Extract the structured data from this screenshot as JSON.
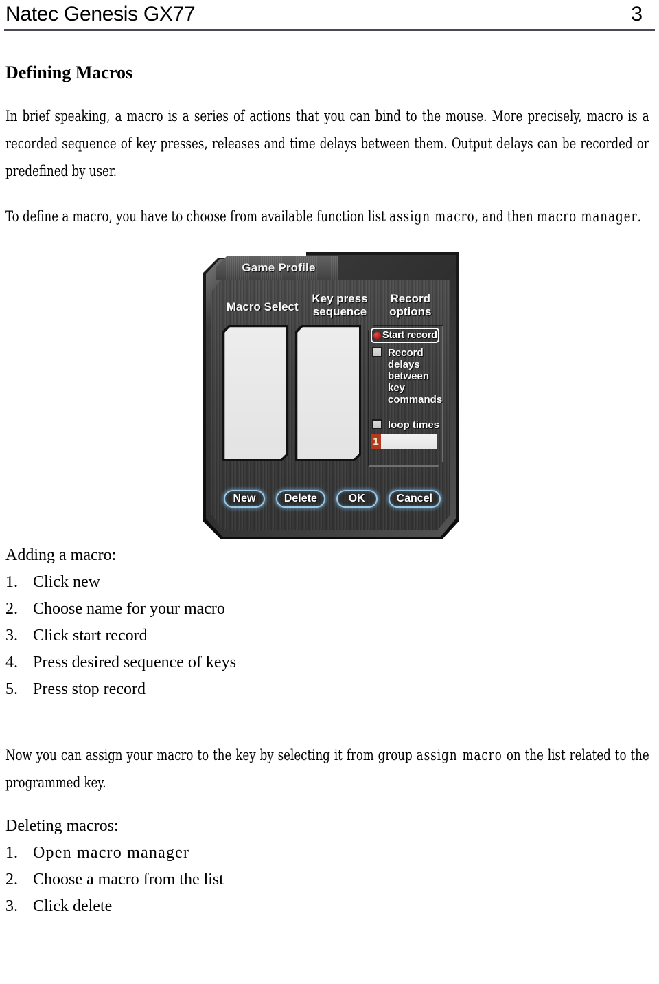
{
  "header": {
    "title": "Natec Genesis GX77",
    "page_number": "3"
  },
  "heading": "Defining Macros",
  "paragraphs": {
    "p1_a": "In brief speaking, a macro is a series of actions that you can bind to the mouse. More precisely, macro is a recorded sequence of key presses, releases and time delays between them. Output delays can be recorded or predefined by user.",
    "p2_a": "To define a macro, you have to choose from available function list ",
    "p2_em1": "assign macro",
    "p2_b": ", and then ",
    "p2_em2": "macro manager",
    "p2_c": ".",
    "p3_a": "Now you can assign your macro to the key by selecting it from group ",
    "p3_em1": "assign macro",
    "p3_b": " on the list related to the programmed key."
  },
  "dialog": {
    "tab_label": "Game Profile",
    "columns": {
      "macro_select": "Macro Select",
      "key_press_sequence": "Key press sequence",
      "record_options": "Record options"
    },
    "start_record_label": "Start record",
    "record_delays_label": "Record delays between key commands",
    "loop_times_label": "loop times",
    "loop_value": "1",
    "buttons": [
      {
        "label": "New"
      },
      {
        "label": "Delete"
      },
      {
        "label": "OK"
      },
      {
        "label": "Cancel"
      }
    ],
    "colors": {
      "panel_dark": "#3d3d3d",
      "listbox_fill": "#ededed",
      "record_dot": "#bf1f1f",
      "button_glow": "#9dc9e8",
      "loop_selection": "#b03a22"
    }
  },
  "lists": {
    "adding": {
      "heading": "Adding a macro:",
      "items": [
        {
          "num": "1.",
          "text": "Click new"
        },
        {
          "num": "2.",
          "text": "Choose name for your macro"
        },
        {
          "num": "3.",
          "text": "Click start record"
        },
        {
          "num": "4.",
          "text": "Press desired sequence of keys"
        },
        {
          "num": "5.",
          "text": "Press stop record"
        }
      ]
    },
    "deleting": {
      "heading": "Deleting macros:",
      "items": [
        {
          "num": "1.",
          "text": "Open macro manager"
        },
        {
          "num": "2.",
          "text": "Choose a macro from the list"
        },
        {
          "num": "3.",
          "text": "Click delete"
        }
      ]
    }
  }
}
